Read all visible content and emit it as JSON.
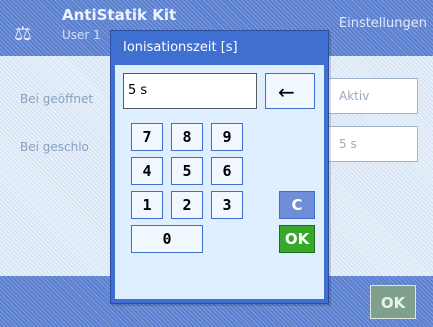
{
  "header": {
    "title": "AntiStatik Kit",
    "subtitle": "User 1",
    "right": "Einstellungen"
  },
  "settings": [
    {
      "label": "Bei geöffnet",
      "value": "Aktiv"
    },
    {
      "label": "Bei geschlo",
      "value": "5 s"
    }
  ],
  "footer": {
    "ok_label": "OK"
  },
  "dialog": {
    "title": "Ionisationszeit [s]",
    "input_value": "5 s",
    "keys": [
      "7",
      "8",
      "9",
      "4",
      "5",
      "6",
      "1",
      "2",
      "3",
      "0"
    ],
    "clear_label": "C",
    "ok_label": "OK",
    "back_icon": "left-arrow-icon"
  },
  "colors": {
    "titlebar": "#3f6fd1",
    "ok_green": "#36a82a",
    "clear_blue": "#6e8ed8"
  }
}
